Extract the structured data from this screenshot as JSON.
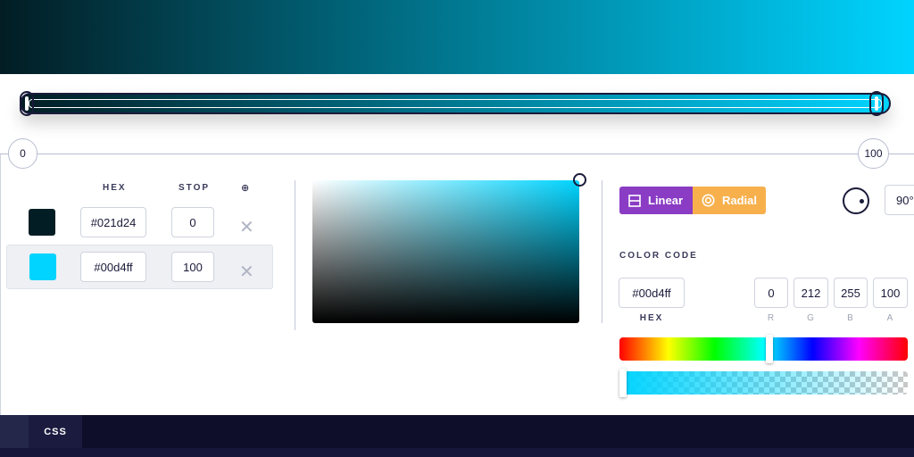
{
  "gradient": {
    "stops": [
      {
        "hex": "#021d24",
        "stop": "0"
      },
      {
        "hex": "#00d4ff",
        "stop": "100"
      }
    ]
  },
  "ruler": {
    "min_label": "0",
    "max_label": "100"
  },
  "table": {
    "hex_header": "HEX",
    "stop_header": "STOP",
    "add_icon": "⊕",
    "delete_icon": "✕"
  },
  "type_buttons": {
    "linear": "Linear",
    "radial": "Radial"
  },
  "angle": {
    "value": "90°"
  },
  "color_code": {
    "label": "COLOR CODE",
    "hex": "#00d4ff",
    "r": "0",
    "g": "212",
    "b": "255",
    "a": "100",
    "hex_label": "HEX",
    "r_label": "R",
    "g_label": "G",
    "b_label": "B",
    "a_label": "A"
  },
  "sliders": {
    "hue_fraction": 0.52,
    "alpha_fraction": 0.0
  },
  "footer": {
    "tab_css": "CSS"
  },
  "colors": {
    "start": "#021d24",
    "end": "#00d4ff",
    "linear_button": "#8a3cc4",
    "radial_button": "#f7b04c",
    "footer_bg": "#0e0e2a"
  }
}
